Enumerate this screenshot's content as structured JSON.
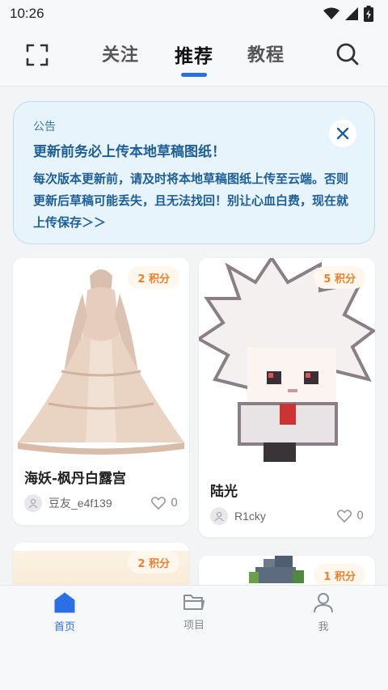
{
  "status": {
    "time": "10:26"
  },
  "nav": {
    "tabs": [
      {
        "label": "关注"
      },
      {
        "label": "推荐"
      },
      {
        "label": "教程"
      }
    ],
    "active_color": "#2b6fe6"
  },
  "notice": {
    "label": "公告",
    "title": "更新前务必上传本地草稿图纸！",
    "body": "每次版本更新前，请及时将本地草稿图纸上传至云端。否则更新后草稿可能丢失，且无法找回！别让心血白费，现在就上传保存＞＞"
  },
  "cards": [
    {
      "points": "2 积分",
      "title": "海妖-枫丹白露宫",
      "author": "豆友_e4f139",
      "likes": "0"
    },
    {
      "points": "5 积分",
      "title": "陆光",
      "author": "R1cky",
      "likes": "0"
    },
    {
      "points": "2 积分"
    },
    {
      "points": "1 积分"
    }
  ],
  "bottom_nav": [
    {
      "label": "首页",
      "icon": "home-icon"
    },
    {
      "label": "项目",
      "icon": "folder-icon"
    },
    {
      "label": "我",
      "icon": "person-icon"
    }
  ]
}
